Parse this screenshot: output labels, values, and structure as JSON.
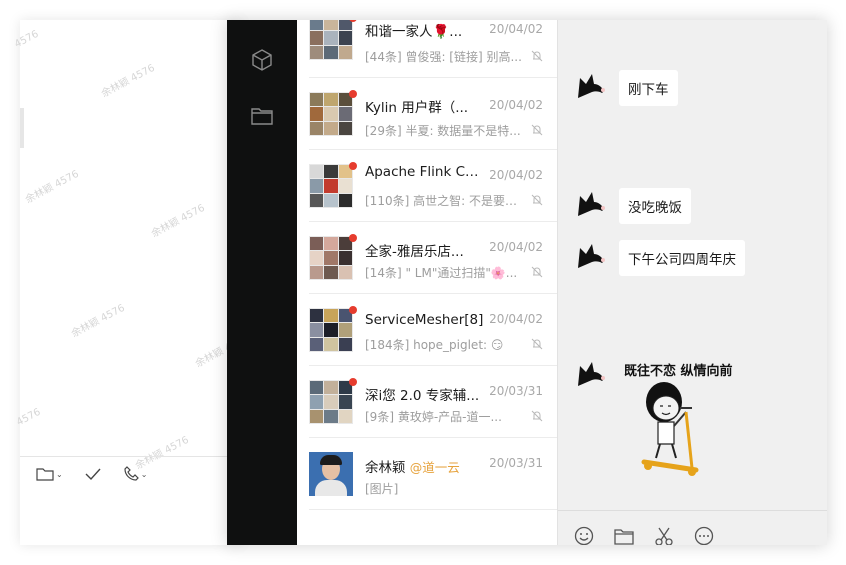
{
  "back_window": {
    "watermarks": [
      "4576",
      "余林颖 4576",
      "余林颖 4576",
      "余林颖 4576",
      "余林颖 4576",
      "余林颖 4576",
      "4576",
      "余林颖 4576"
    ],
    "toolbar": [
      "folder-icon",
      "check-icon",
      "phone-icon"
    ]
  },
  "sidebar": {
    "icons": [
      "cube-icon",
      "folder-icon"
    ]
  },
  "conversations": [
    {
      "name": "和谐一家人🌹...",
      "date": "20/04/02",
      "preview": "[44条] 曾俊强: [链接] 别高...",
      "unread": true,
      "muted": true
    },
    {
      "name": "Kylin 用户群（...",
      "date": "20/04/02",
      "preview": "[29条] 半夏: 数据量不是特...",
      "unread": true,
      "muted": true
    },
    {
      "name": "Apache Flink Chi...",
      "date": "20/04/02",
      "preview": "[110条] 高世之智: 不是要统...",
      "unread": true,
      "muted": true
    },
    {
      "name": "全家-雅居乐店...",
      "date": "20/04/02",
      "preview": "[14条] \" LM\"通过扫描\"🌸...",
      "unread": true,
      "muted": true
    },
    {
      "name": "ServiceMesher[8]",
      "date": "20/04/02",
      "preview": "[184条] hope_piglet: 😏",
      "unread": true,
      "muted": true
    },
    {
      "name": "深i您 2.0 专家辅...",
      "date": "20/03/31",
      "preview": "[9条] 黄玫婷-产品-道一...",
      "unread": true,
      "muted": true
    },
    {
      "name": "余林颖",
      "mention": "@道一云",
      "date": "20/03/31",
      "preview": "[图片]",
      "unread": false,
      "muted": false
    }
  ],
  "chat": {
    "messages": [
      "刚下车",
      "没吃晚饭",
      "下午公司四周年庆"
    ],
    "sticker_caption": "既往不恋 纵情向前",
    "tools": [
      "emoji-icon",
      "folder-icon",
      "scissors-icon",
      "more-icon"
    ]
  }
}
